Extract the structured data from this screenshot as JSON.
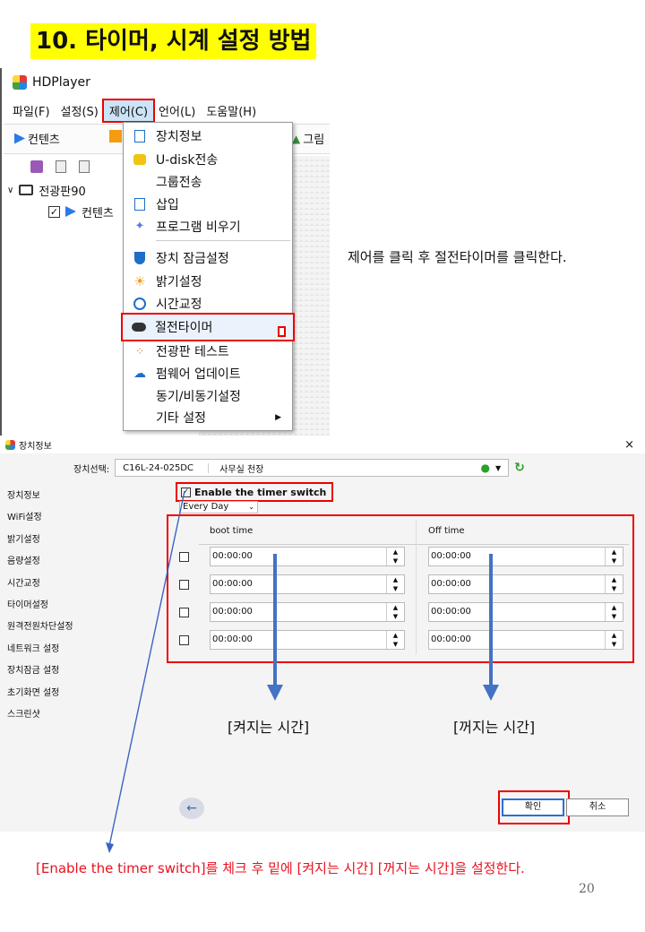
{
  "title": "10. 타이머, 시계 설정 방법",
  "screenshot1": {
    "app_title": "HDPlayer",
    "menu": [
      "파일(F)",
      "설정(S)",
      "제어(C)",
      "언어(L)",
      "도움말(H)"
    ],
    "toolbar": {
      "content": "컨텐츠",
      "image": "그림"
    },
    "tree": {
      "root": "전광판90",
      "child": "컨텐츠"
    },
    "dropdown": [
      "장치정보",
      "U-disk전송",
      "그룹전송",
      "삽입",
      "프로그램 비우기",
      "장치 잠금설정",
      "밝기설정",
      "시간교정",
      "절전타이머",
      "전광판 테스트",
      "펌웨어 업데이트",
      "동기/비동기설정",
      "기타 설정"
    ]
  },
  "caption1": "제어를 클릭 후 절전타이머를 클릭한다.",
  "dialog": {
    "title": "장치정보",
    "close": "×",
    "device_label": "장치선택:",
    "device_id": "C16L-24-025DC",
    "device_name": "사무실 천장",
    "sidebar": [
      "장치정보",
      "WiFi설정",
      "밝기설정",
      "음량설정",
      "시간교정",
      "타이머설정",
      "원격전원차단설정",
      "네트워크 설정",
      "장치잠금 설정",
      "초기화면 설정",
      "스크린샷"
    ],
    "enable_label": "Enable the timer switch",
    "repeat": "Every Day",
    "col_boot": "boot time",
    "col_off": "Off time",
    "rows": [
      {
        "boot": "00:00:00",
        "off": "00:00:00"
      },
      {
        "boot": "00:00:00",
        "off": "00:00:00"
      },
      {
        "boot": "00:00:00",
        "off": "00:00:00"
      },
      {
        "boot": "00:00:00",
        "off": "00:00:00"
      }
    ],
    "label_on": "[켜지는 시간]",
    "label_off": "[꺼지는 시간]",
    "ok": "확인",
    "cancel": "취소"
  },
  "caption2": "[Enable the timer switch]를 체크 후 밑에 [켜지는 시간] [꺼지는 시간]을 설정한다.",
  "page_number": "20"
}
